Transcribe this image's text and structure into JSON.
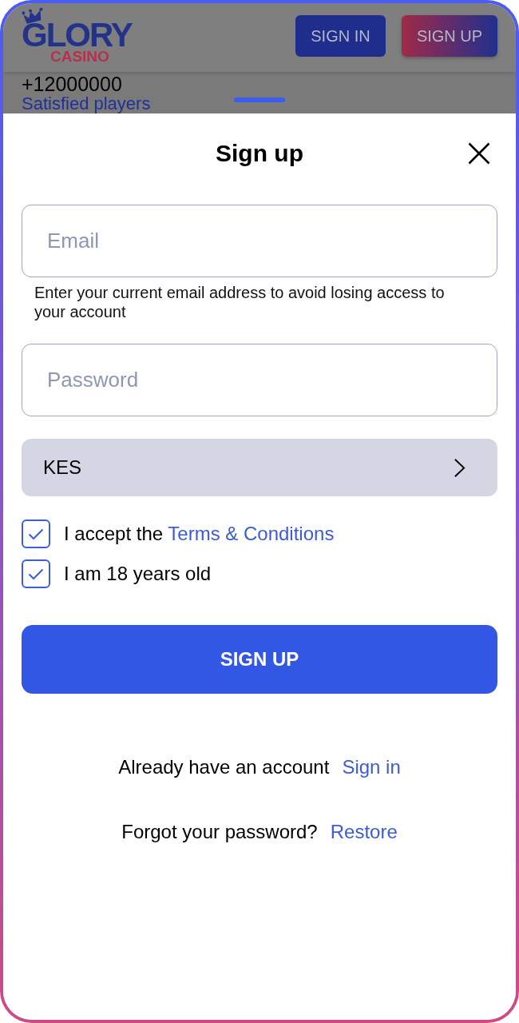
{
  "header": {
    "logo": {
      "title": "GLORY",
      "subtitle": "CASINO"
    },
    "buttons": [
      {
        "label": "SIGN IN",
        "kind": "secondary"
      },
      {
        "label": "SIGN UP",
        "kind": "primary"
      }
    ]
  },
  "background": {
    "stat_value": "+12000000",
    "stat_label": "Satisfied players"
  },
  "dialog": {
    "title": "Sign up",
    "fields": [
      {
        "kind": "input",
        "placeholder": "Email",
        "hint": "Enter your current email address to avoid losing access to your account"
      },
      {
        "kind": "input",
        "placeholder": "Password"
      },
      {
        "kind": "select",
        "value": "KES"
      }
    ],
    "checkboxes": [
      {
        "label": "I accept the",
        "link": "Terms & Conditions",
        "checked": true
      },
      {
        "label": "I am 18 years old",
        "checked": true
      }
    ],
    "submit": "SIGN UP",
    "links": [
      {
        "text": "Already have an account",
        "link": "Sign in"
      },
      {
        "text": "Forgot your password?",
        "link": "Restore"
      }
    ]
  }
}
